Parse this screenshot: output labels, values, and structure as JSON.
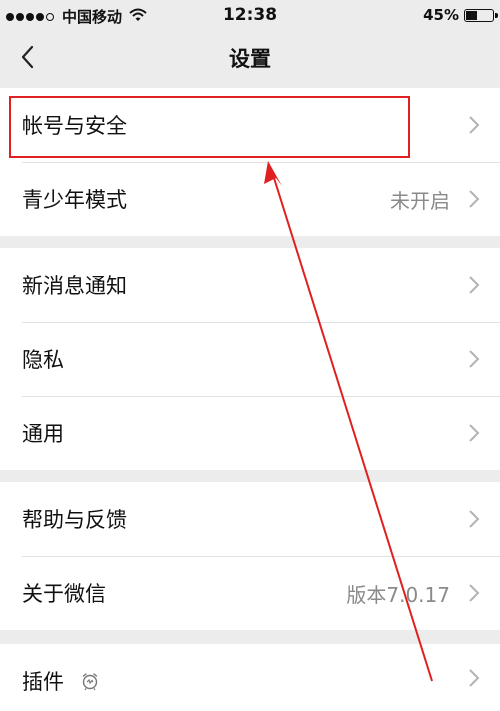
{
  "status_bar": {
    "carrier": "中国移动",
    "time": "12:38",
    "battery_percent": "45%",
    "battery_level": 0.45,
    "signal_dots_filled": 4,
    "signal_dots_total": 5
  },
  "nav": {
    "title": "设置",
    "back_icon": "chevron-left-icon"
  },
  "groups": [
    {
      "items": [
        {
          "label": "帐号与安全",
          "value": "",
          "highlighted": true
        },
        {
          "label": "青少年模式",
          "value": "未开启"
        }
      ]
    },
    {
      "items": [
        {
          "label": "新消息通知",
          "value": ""
        },
        {
          "label": "隐私",
          "value": ""
        },
        {
          "label": "通用",
          "value": ""
        }
      ]
    },
    {
      "items": [
        {
          "label": "帮助与反馈",
          "value": ""
        },
        {
          "label": "关于微信",
          "value": "版本7.0.17"
        }
      ]
    },
    {
      "items": [
        {
          "label": "插件",
          "value": "",
          "icon": "plugin-icon"
        }
      ]
    }
  ],
  "annotation": {
    "color": "#e02020",
    "target": "帐号与安全"
  }
}
